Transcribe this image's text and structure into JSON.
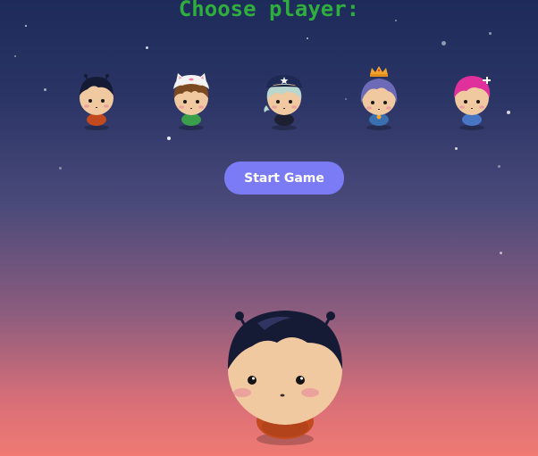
{
  "title": "Choose player:",
  "start_button_label": "Start Game",
  "players": [
    {
      "name": "black-hair-antenna-icon",
      "hair_color": "#151a35",
      "body_color": "#c24a1e"
    },
    {
      "name": "cat-hat-brown-hair-icon",
      "hair_color": "#7b4a22",
      "body_color": "#3b9e4a",
      "hat_color": "#f3f3f3"
    },
    {
      "name": "police-cap-silver-hair-icon",
      "hair_color": "#b9d6cf",
      "body_color": "#1d2030",
      "hat_color": "#1e2a55"
    },
    {
      "name": "crown-purple-hair-icon",
      "hair_color": "#6d6bb8",
      "body_color": "#3a6fb0",
      "crown_color": "#f2a52a"
    },
    {
      "name": "pink-hair-cross-icon",
      "hair_color": "#e0309c",
      "body_color": "#4876c4"
    }
  ],
  "selected_player": {
    "name": "selected-black-hair-antenna-icon",
    "hair_color": "#151a35",
    "body_color": "#c24a1e"
  },
  "colors": {
    "title": "#2fae3d",
    "button": "#7b7bf5",
    "button_text": "#ffffff",
    "sky_top": "#1d2b5a",
    "sky_bottom": "#f07a72"
  }
}
